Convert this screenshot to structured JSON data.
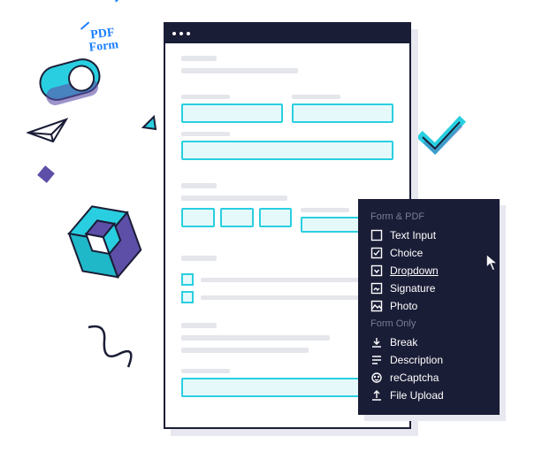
{
  "badge": {
    "line1": "PDF",
    "line2": "Form"
  },
  "menu": {
    "section1": "Form & PDF",
    "section2": "Form Only",
    "items1": [
      {
        "label": "Text Input",
        "icon": "text-input-icon"
      },
      {
        "label": "Choice",
        "icon": "choice-icon"
      },
      {
        "label": "Dropdown",
        "icon": "dropdown-icon"
      },
      {
        "label": "Signature",
        "icon": "signature-icon"
      },
      {
        "label": "Photo",
        "icon": "photo-icon"
      }
    ],
    "items2": [
      {
        "label": "Break",
        "icon": "break-icon"
      },
      {
        "label": "Description",
        "icon": "description-icon"
      },
      {
        "label": "reCaptcha",
        "icon": "recaptcha-icon"
      },
      {
        "label": "File Upload",
        "icon": "file-upload-icon"
      }
    ]
  }
}
